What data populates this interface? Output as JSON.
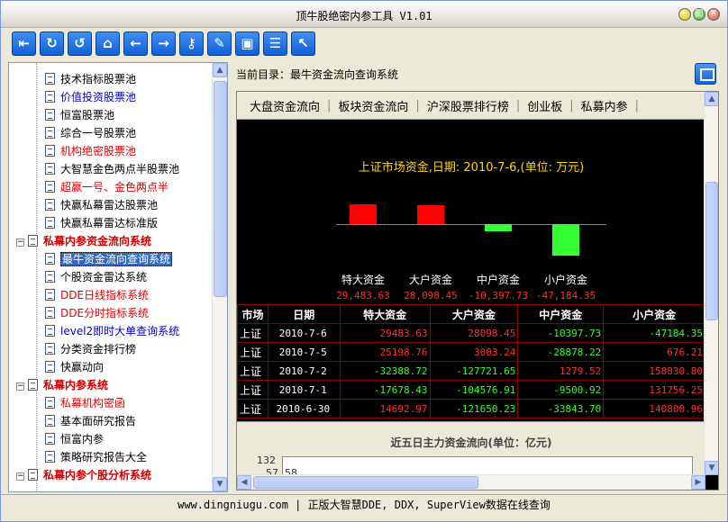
{
  "window": {
    "title": "顶牛股绝密内参工具 V1.01"
  },
  "toolbar": {
    "icons": [
      "exit-icon",
      "refresh-icon",
      "undo-icon",
      "home-icon",
      "back-arrow-icon",
      "forward-arrow-icon",
      "key-icon",
      "eraser-icon",
      "save-icon",
      "book-icon",
      "cursor-icon"
    ]
  },
  "tree": {
    "items": [
      {
        "label": "技术指标股票池",
        "color": "black",
        "type": "leaf"
      },
      {
        "label": "价值投资股票池",
        "color": "blue",
        "type": "leaf"
      },
      {
        "label": "恒富股票池",
        "color": "black",
        "type": "leaf"
      },
      {
        "label": "综合一号股票池",
        "color": "black",
        "type": "leaf"
      },
      {
        "label": "机构绝密股票池",
        "color": "red",
        "type": "leaf"
      },
      {
        "label": "大智慧金色两点半股票池",
        "color": "black",
        "type": "leaf"
      },
      {
        "label": "超赢一号、金色两点半",
        "color": "red",
        "type": "leaf"
      },
      {
        "label": "快赢私幕雷达股票池",
        "color": "black",
        "type": "leaf"
      },
      {
        "label": "快赢私幕雷达标准版",
        "color": "black",
        "type": "leaf"
      },
      {
        "label": "私幕内参资金流向系统",
        "color": "bold-red",
        "type": "group"
      },
      {
        "label": "最牛资金流向查询系统",
        "color": "black",
        "type": "leaf",
        "selected": true
      },
      {
        "label": "个股资金雷达系统",
        "color": "black",
        "type": "leaf"
      },
      {
        "label": "DDE日线指标系统",
        "color": "red",
        "type": "leaf"
      },
      {
        "label": "DDE分时指标系统",
        "color": "red",
        "type": "leaf"
      },
      {
        "label": "level2即时大单查询系统",
        "color": "blue",
        "type": "leaf"
      },
      {
        "label": "分类资金排行榜",
        "color": "black",
        "type": "leaf"
      },
      {
        "label": "快赢动向",
        "color": "black",
        "type": "leaf"
      },
      {
        "label": "私幕内参系统",
        "color": "bold-red",
        "type": "group"
      },
      {
        "label": "私幕机构密函",
        "color": "red",
        "type": "leaf"
      },
      {
        "label": "基本面研究报告",
        "color": "black",
        "type": "leaf"
      },
      {
        "label": "恒富内参",
        "color": "black",
        "type": "leaf"
      },
      {
        "label": "策略研究报告大全",
        "color": "black",
        "type": "leaf"
      },
      {
        "label": "私幕内参个股分析系统",
        "color": "bold-red",
        "type": "group"
      }
    ]
  },
  "right": {
    "current_dir_label": "当前目录：",
    "current_dir": "最牛资金流向查询系统",
    "tabs": [
      "大盘资金流向",
      "板块资金流向",
      "沪深股票排行榜",
      "创业板",
      "私募内参"
    ]
  },
  "chart_data": {
    "type": "bar",
    "title": "上证市场资金,日期: 2010-7-6,(单位: 万元)",
    "categories": [
      "特大资金",
      "大户资金",
      "中户资金",
      "小户资金"
    ],
    "values": [
      29483.63,
      28098.45,
      -10397.73,
      -47184.35
    ],
    "value_labels": [
      "29,483.63",
      "28,098.45",
      "-10,397.73",
      "-47,184.35"
    ],
    "positive_color": "#ff0000",
    "negative_color": "#33ff33"
  },
  "table": {
    "headers": [
      "市场",
      "日期",
      "特大资金",
      "大户资金",
      "中户资金",
      "小户资金"
    ],
    "rows": [
      {
        "market": "上证",
        "date": "2010-7-6",
        "c1": "29483.63",
        "c2": "28098.45",
        "c3": "-10397.73",
        "c4": "-47184.35"
      },
      {
        "market": "上证",
        "date": "2010-7-5",
        "c1": "25198.76",
        "c2": "3003.24",
        "c3": "-28878.22",
        "c4": "676.21"
      },
      {
        "market": "上证",
        "date": "2010-7-2",
        "c1": "-32388.72",
        "c2": "-127721.65",
        "c3": "1279.52",
        "c4": "158830.80"
      },
      {
        "market": "上证",
        "date": "2010-7-1",
        "c1": "-17678.43",
        "c2": "-104576.91",
        "c3": "-9500.92",
        "c4": "131756.25"
      },
      {
        "market": "上证",
        "date": "2010-6-30",
        "c1": "14692.97",
        "c2": "-121650.23",
        "c3": "-33843.70",
        "c4": "140800.96"
      }
    ]
  },
  "lower_chart": {
    "title": "近五日主力资金流向(单位：亿元)",
    "y_top": "132",
    "y_second": "57",
    "x_first": "58"
  },
  "status": {
    "text": "www.dingniugu.com | 正版大智慧DDE, DDX, SuperView数据在线查询"
  }
}
